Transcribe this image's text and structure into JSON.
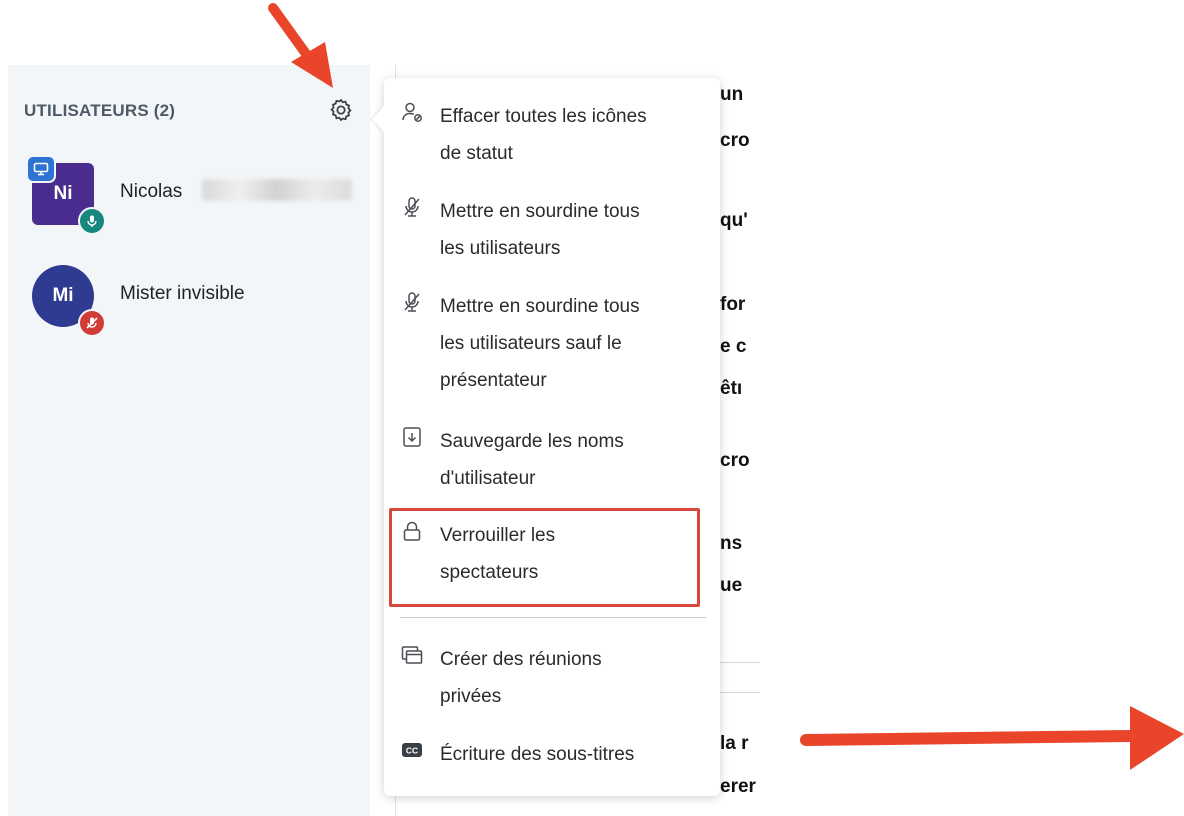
{
  "sidebar": {
    "title": "UTILISATEURS (2)",
    "users": [
      {
        "initials": "Ni",
        "name": "Nicolas",
        "mic": "on",
        "presenter": true
      },
      {
        "initials": "Mi",
        "name": "Mister invisible",
        "mic": "muted",
        "presenter": false
      }
    ]
  },
  "menu": {
    "items": [
      {
        "id": "clear-status",
        "icon": "user-status-icon",
        "line1": "Effacer toutes les icônes",
        "line2": "de statut"
      },
      {
        "id": "mute-all",
        "icon": "mic-off-icon",
        "line1": "Mettre en sourdine tous",
        "line2": "les utilisateurs"
      },
      {
        "id": "mute-all-except",
        "icon": "mic-off-icon",
        "line1": "Mettre en sourdine tous",
        "line2": "les utilisateurs sauf le",
        "line3": "présentateur"
      },
      {
        "id": "save-names",
        "icon": "download-file-icon",
        "line1": "Sauvegarde les noms",
        "line2": "d'utilisateur"
      },
      {
        "id": "lock-viewers",
        "icon": "lock-icon",
        "line1": "Verrouiller les",
        "line2": "spectateurs"
      },
      {
        "id": "breakout",
        "icon": "breakout-rooms-icon",
        "line1": "Créer des réunions",
        "line2": "privées"
      },
      {
        "id": "captions",
        "icon": "closed-captions-icon",
        "line1": "Écriture des sous-titres"
      }
    ]
  },
  "content_fragments": [
    "un",
    "cro",
    "qu'",
    "for",
    "e c",
    "êtı",
    "cro",
    "ns",
    "ue",
    "la r",
    "erer"
  ],
  "colors": {
    "sidebar_bg": "#f3f6f9",
    "avatar_ni": "#4a2c8f",
    "avatar_mi": "#2f3a91",
    "mic_on": "#17887f",
    "mic_muted": "#d13c36",
    "presenter": "#2c73d2",
    "highlight": "#d6483c",
    "annotation_arrow": "#e8452a"
  }
}
